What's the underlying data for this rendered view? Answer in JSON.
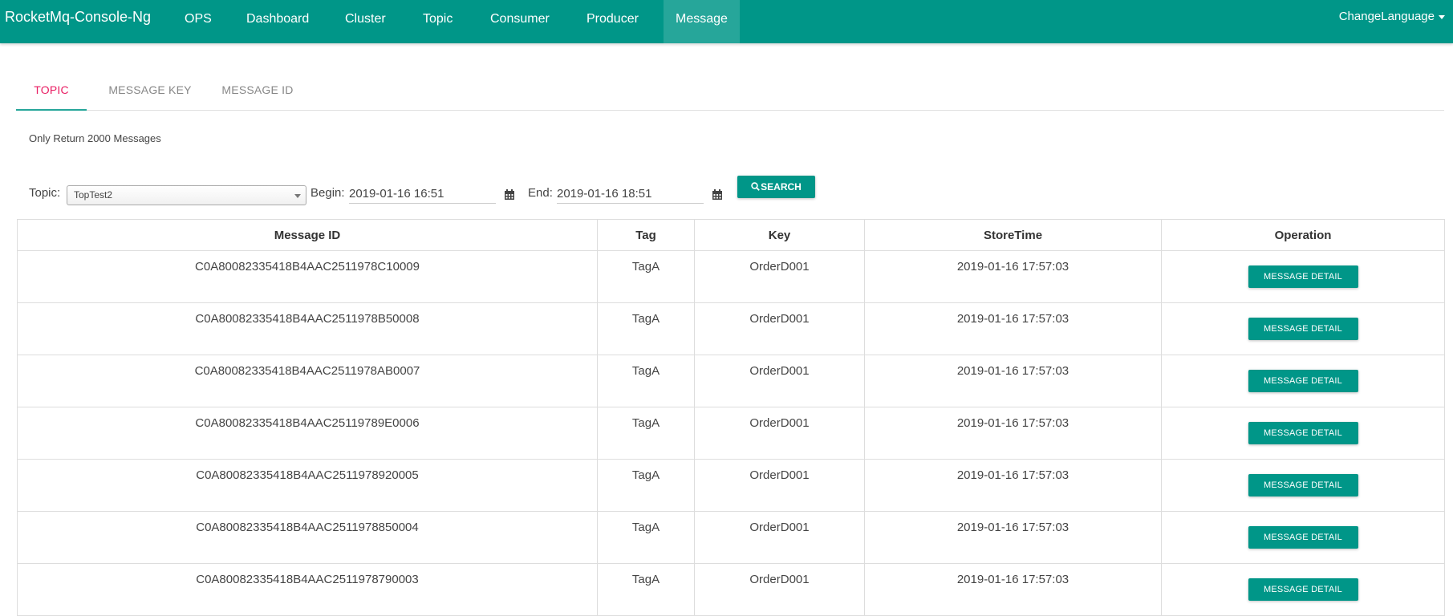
{
  "navbar": {
    "brand": "RocketMq-Console-Ng",
    "items": [
      {
        "label": "OPS"
      },
      {
        "label": "Dashboard"
      },
      {
        "label": "Cluster"
      },
      {
        "label": "Topic"
      },
      {
        "label": "Consumer"
      },
      {
        "label": "Producer"
      },
      {
        "label": "Message",
        "active": true
      }
    ],
    "language": "ChangeLanguage"
  },
  "tabs": [
    {
      "label": "TOPIC",
      "active": true
    },
    {
      "label": "MESSAGE KEY"
    },
    {
      "label": "MESSAGE ID"
    }
  ],
  "notice": "Only Return 2000 Messages",
  "filter": {
    "topic_label": "Topic:",
    "topic_value": "TopTest2",
    "begin_label": "Begin:",
    "begin_value": "2019-01-16 16:51",
    "end_label": "End:",
    "end_value": "2019-01-16 18:51",
    "search_label": "SEARCH"
  },
  "table": {
    "headers": [
      "Message ID",
      "Tag",
      "Key",
      "StoreTime",
      "Operation"
    ],
    "detail_label": "MESSAGE DETAIL",
    "rows": [
      {
        "id": "C0A80082335418B4AAC2511978C10009",
        "tag": "TagA",
        "key": "OrderD001",
        "time": "2019-01-16 17:57:03"
      },
      {
        "id": "C0A80082335418B4AAC2511978B50008",
        "tag": "TagA",
        "key": "OrderD001",
        "time": "2019-01-16 17:57:03"
      },
      {
        "id": "C0A80082335418B4AAC2511978AB0007",
        "tag": "TagA",
        "key": "OrderD001",
        "time": "2019-01-16 17:57:03"
      },
      {
        "id": "C0A80082335418B4AAC25119789E0006",
        "tag": "TagA",
        "key": "OrderD001",
        "time": "2019-01-16 17:57:03"
      },
      {
        "id": "C0A80082335418B4AAC2511978920005",
        "tag": "TagA",
        "key": "OrderD001",
        "time": "2019-01-16 17:57:03"
      },
      {
        "id": "C0A80082335418B4AAC2511978850004",
        "tag": "TagA",
        "key": "OrderD001",
        "time": "2019-01-16 17:57:03"
      },
      {
        "id": "C0A80082335418B4AAC2511978790003",
        "tag": "TagA",
        "key": "OrderD001",
        "time": "2019-01-16 17:57:03"
      }
    ]
  },
  "icons": {
    "calendar": "calendar-icon",
    "search": "search-icon",
    "dropdown": "chevron-down-icon"
  },
  "colors": {
    "primary": "#009688",
    "active_tab_text": "#e91e63"
  }
}
